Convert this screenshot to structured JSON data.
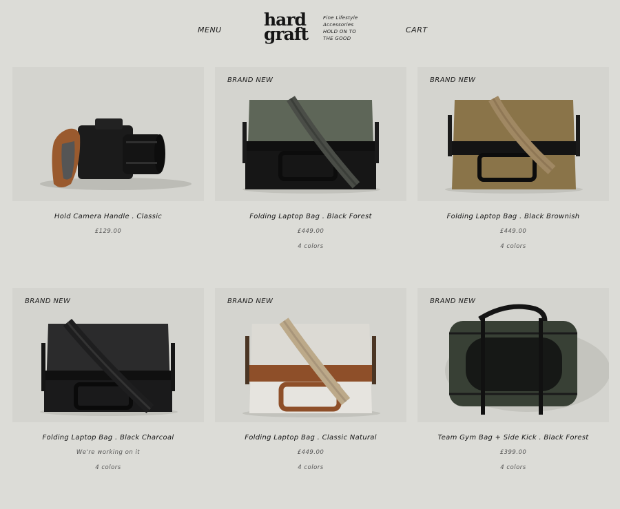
{
  "header": {
    "menu_label": "MENU",
    "cart_label": "CART",
    "logo_line1": "hard",
    "logo_line2": "graft",
    "tagline": [
      "Fine Lifestyle",
      "Accessories",
      "HOLD ON TO",
      "THE GOOD"
    ]
  },
  "products": [
    {
      "badge": "",
      "title": "Hold Camera Handle . Classic",
      "price": "£129.00",
      "colors": "",
      "image": "camera-handle"
    },
    {
      "badge": "BRAND NEW",
      "title": "Folding Laptop Bag . Black Forest",
      "price": "£449.00",
      "colors": "4 colors",
      "image": "bag-forest"
    },
    {
      "badge": "BRAND NEW",
      "title": "Folding Laptop Bag . Black Brownish",
      "price": "£449.00",
      "colors": "4 colors",
      "image": "bag-brownish"
    },
    {
      "badge": "BRAND NEW",
      "title": "Folding Laptop Bag . Black Charcoal",
      "price": "We're working on it",
      "colors": "4 colors",
      "image": "bag-charcoal"
    },
    {
      "badge": "BRAND NEW",
      "title": "Folding Laptop Bag . Classic Natural",
      "price": "£449.00",
      "colors": "4 colors",
      "image": "bag-natural"
    },
    {
      "badge": "BRAND NEW",
      "title": "Team Gym Bag + Side Kick . Black Forest",
      "price": "£399.00",
      "colors": "4 colors",
      "image": "gym-bag"
    }
  ],
  "palette": {
    "background": "#dcdcd7",
    "forest": "#5e6658",
    "brownish": "#8a7449",
    "charcoal": "#2b2b2c",
    "natural": "#e6e4df",
    "leather": "#9a5a2e",
    "black_leather": "#161616"
  }
}
